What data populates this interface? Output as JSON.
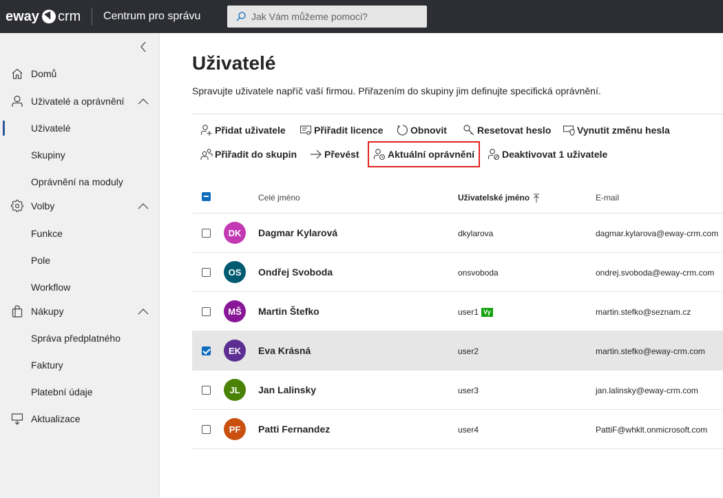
{
  "header": {
    "logo_part1": "eway",
    "logo_part2": "crm",
    "app_title": "Centrum pro správu",
    "search_placeholder": "Jak Vám můžeme pomoci?"
  },
  "sidebar": {
    "items": [
      {
        "label": "Domů",
        "icon": "home-icon"
      },
      {
        "label": "Uživatelé a oprávnění",
        "icon": "person-icon",
        "expanded": true
      },
      {
        "label": "Uživatelé",
        "active": true
      },
      {
        "label": "Skupiny"
      },
      {
        "label": "Oprávnění na moduly"
      },
      {
        "label": "Volby",
        "icon": "gear-icon",
        "expanded": true
      },
      {
        "label": "Funkce"
      },
      {
        "label": "Pole"
      },
      {
        "label": "Workflow"
      },
      {
        "label": "Nákupy",
        "icon": "shopping-bag-icon",
        "expanded": true
      },
      {
        "label": "Správa předplatného"
      },
      {
        "label": "Faktury"
      },
      {
        "label": "Platební údaje"
      },
      {
        "label": "Aktualizace",
        "icon": "update-icon"
      }
    ]
  },
  "main": {
    "title": "Uživatelé",
    "description": "Spravujte uživatele napříč vaší firmou. Přiřazením do skupiny jim definujte specifická oprávnění.",
    "toolbar": {
      "add_user": "Přidat uživatele",
      "assign_license": "Přiřadit licence",
      "refresh": "Obnovit",
      "reset_password": "Resetovat heslo",
      "force_password_change": "Vynutit změnu hesla",
      "assign_groups": "Přiřadit do skupin",
      "transfer": "Převést",
      "current_permissions": "Aktuální oprávnění",
      "deactivate": "Deaktivovat 1 uživatele"
    },
    "table": {
      "columns": [
        "Celé jméno",
        "Uživatelské jméno",
        "E-mail"
      ],
      "sort_column": "Uživatelské jméno",
      "rows": [
        {
          "initials": "DK",
          "color": "#c239b3",
          "name": "Dagmar Kylarová",
          "username": "dkylarova",
          "badge": "",
          "email": "dagmar.kylarova@eway-crm.com",
          "selected": false
        },
        {
          "initials": "OS",
          "color": "#005b70",
          "name": "Ondřej Svoboda",
          "username": "onsvoboda",
          "badge": "",
          "email": "ondrej.svoboda@eway-crm.com",
          "selected": false
        },
        {
          "initials": "MŠ",
          "color": "#881798",
          "name": "Martin Štefko",
          "username": "user1",
          "badge": "Vy",
          "email": "martin.stefko@seznam.cz",
          "selected": false
        },
        {
          "initials": "EK",
          "color": "#5c2e91",
          "name": "Eva Krásná",
          "username": "user2",
          "badge": "",
          "email": "martin.stefko@eway-crm.com",
          "selected": true
        },
        {
          "initials": "JL",
          "color": "#498205",
          "name": "Jan Lalinsky",
          "username": "user3",
          "badge": "",
          "email": "jan.lalinsky@eway-crm.com",
          "selected": false
        },
        {
          "initials": "PF",
          "color": "#ca5010",
          "name": "Patti Fernandez",
          "username": "user4",
          "badge": "",
          "email": "PattiF@whklt.onmicrosoft.com",
          "selected": false
        }
      ]
    }
  },
  "colors": {
    "topbar": "#2d2e33",
    "sidebar": "#f0f0f0",
    "accent": "#0f6cbd",
    "highlight_border": "#e0201f"
  }
}
